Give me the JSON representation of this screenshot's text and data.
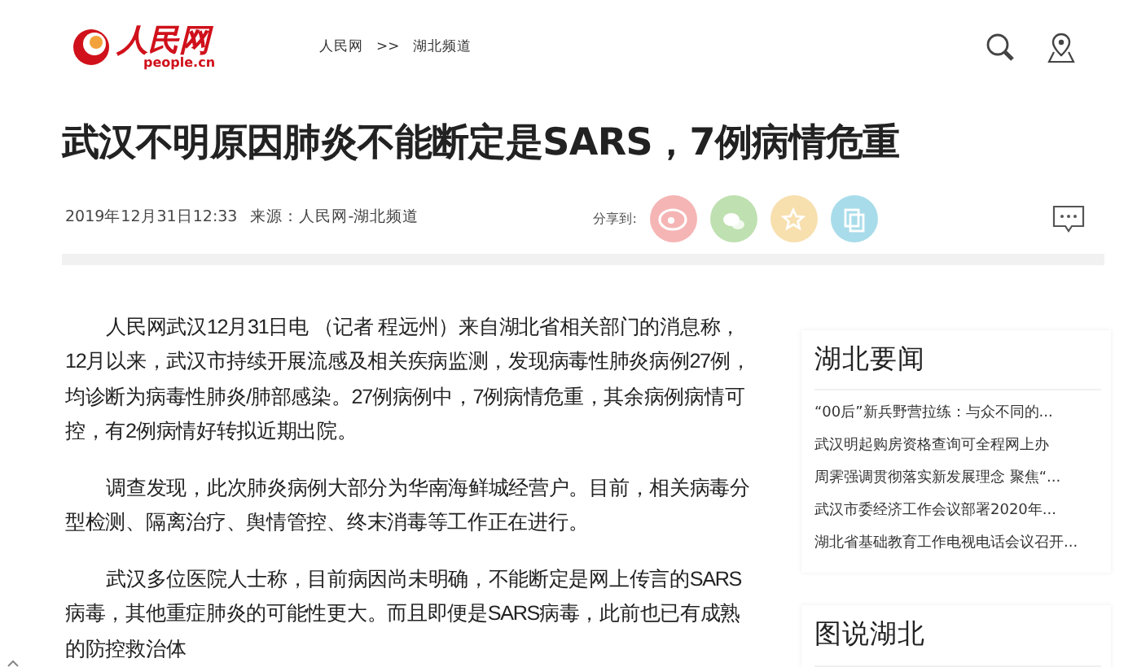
{
  "header": {
    "logo_text": "人民网",
    "logo_domain": "people.cn",
    "breadcrumb": [
      "人民网",
      ">>",
      "湖北频道"
    ]
  },
  "article": {
    "title": "武汉不明原因肺炎不能断定是SARS，7例病情危重",
    "date": "2019年12月31日12:33",
    "source": "来源：人民网-湖北频道",
    "share_label": "分享到:",
    "share_buttons": [
      {
        "kind": "weibo",
        "color": "#f5b5b5"
      },
      {
        "kind": "wechat",
        "color": "#bfe0b0"
      },
      {
        "kind": "favorite",
        "color": "#f7dfae"
      },
      {
        "kind": "copy",
        "color": "#a9dcea"
      }
    ],
    "paragraphs": [
      "人民网武汉12月31日电 （记者 程远州）来自湖北省相关部门的消息称，12月以来，武汉市持续开展流感及相关疾病监测，发现病毒性肺炎病例27例，均诊断为病毒性肺炎/肺部感染。27例病例中，7例病情危重，其余病例病情可控，有2例病情好转拟近期出院。",
      "调查发现，此次肺炎病例大部分为华南海鲜城经营户。目前，相关病毒分型检测、隔离治疗、舆情管控、终末消毒等工作正在进行。",
      "武汉多位医院人士称，目前病因尚未明确，不能断定是网上传言的SARS病毒，其他重症肺炎的可能性更大。而且即便是SARS病毒，此前也已有成熟的防控救治体"
    ]
  },
  "sidebar": [
    {
      "title": "湖北要闻",
      "items": [
        "“00后”新兵野营拉练：与众不同的...",
        "武汉明起购房资格查询可全程网上办",
        "周霁强调贯彻落实新发展理念 聚焦“...",
        "武汉市委经济工作会议部署2020年...",
        "湖北省基础教育工作电视电话会议召开..."
      ]
    },
    {
      "title": "图说湖北"
    }
  ]
}
